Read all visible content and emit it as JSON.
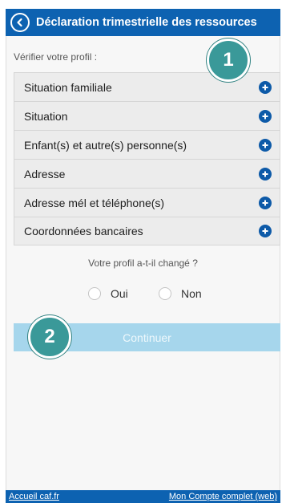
{
  "header": {
    "title": "Déclaration trimestrielle des ressources",
    "back_icon": "chevron-left-circle-icon"
  },
  "profile": {
    "check_label": "Vérifier votre profil :",
    "sections": [
      {
        "label": "Situation familiale",
        "icon": "plus-circle-icon"
      },
      {
        "label": "Situation",
        "icon": "plus-circle-icon"
      },
      {
        "label": "Enfant(s) et autre(s) personne(s)",
        "icon": "plus-circle-icon"
      },
      {
        "label": "Adresse",
        "icon": "plus-circle-icon"
      },
      {
        "label": "Adresse mél et téléphone(s)",
        "icon": "plus-circle-icon"
      },
      {
        "label": "Coordonnées bancaires",
        "icon": "plus-circle-icon"
      }
    ]
  },
  "question": {
    "text": "Votre profil a-t-il changé ?",
    "options": [
      {
        "label": "Oui",
        "selected": false
      },
      {
        "label": "Non",
        "selected": false
      }
    ]
  },
  "continue_button": {
    "label": "Continuer",
    "enabled": false
  },
  "annotations": [
    {
      "number": "1"
    },
    {
      "number": "2"
    }
  ],
  "footer": {
    "left_link": "Accueil caf.fr",
    "right_link": "Mon Compte complet (web)"
  },
  "colors": {
    "header_blue": "#0d62b1",
    "accent_blue": "#0d5aa8",
    "button_disabled": "#a6d6ec",
    "badge_teal": "#3a9999"
  }
}
